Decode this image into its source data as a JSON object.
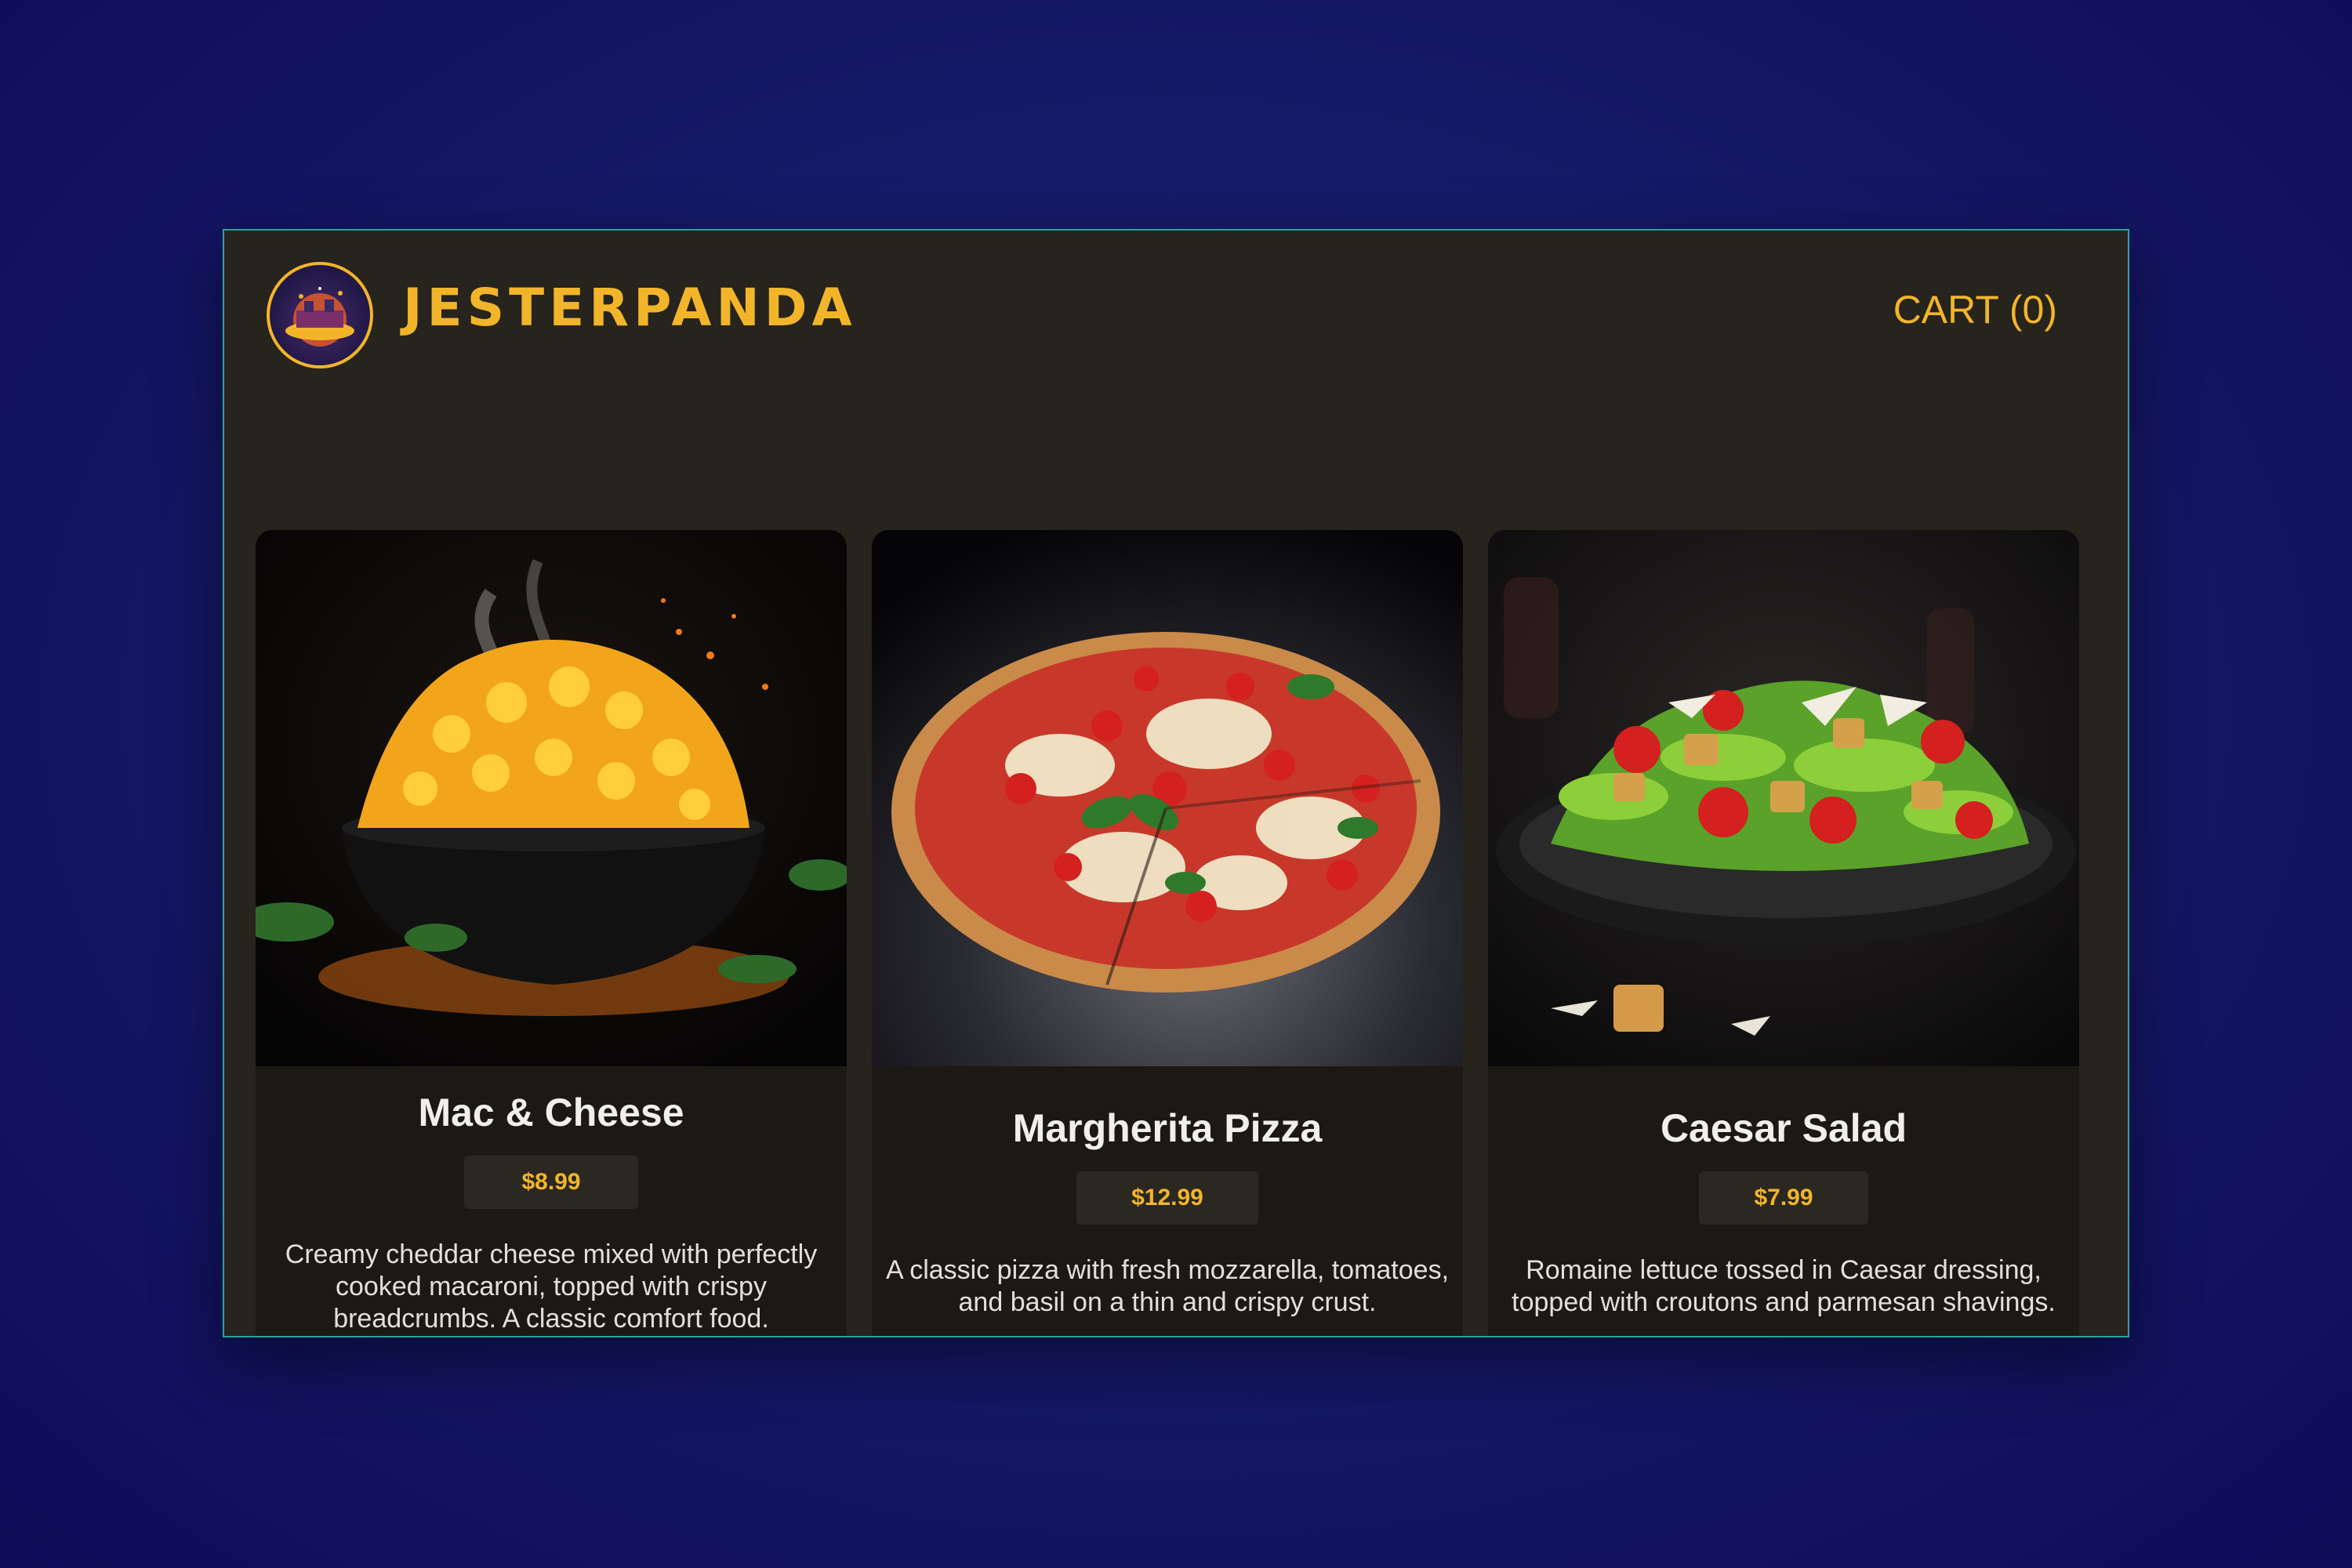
{
  "header": {
    "brand": "JESTERPANDA",
    "cart_label": "CART (0)",
    "logo_icon": "restaurant-logo-icon"
  },
  "products": [
    {
      "title": "Mac & Cheese",
      "price": "$8.99",
      "description": "Creamy cheddar cheese mixed with perfectly cooked macaroni, topped with crispy breadcrumbs. A classic comfort food.",
      "image_icon": "mac-and-cheese-image"
    },
    {
      "title": "Margherita Pizza",
      "price": "$12.99",
      "description": "A classic pizza with fresh mozzarella, tomatoes, and basil on a thin and crispy crust.",
      "image_icon": "pizza-image"
    },
    {
      "title": "Caesar Salad",
      "price": "$7.99",
      "description": "Romaine lettuce tossed in Caesar dressing, topped with croutons and parmesan shavings.",
      "image_icon": "salad-image"
    }
  ],
  "colors": {
    "accent": "#f2b52a",
    "panel": "#27231d",
    "card": "#1c1915",
    "border": "#2aa39a",
    "background": "#161a68"
  }
}
